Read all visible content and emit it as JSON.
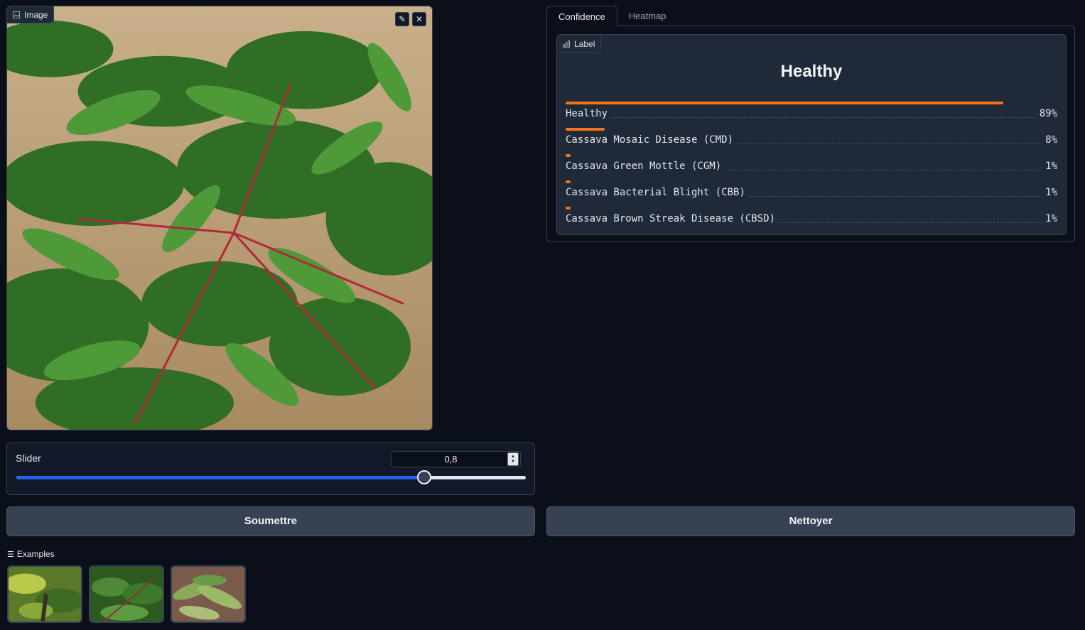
{
  "image_input": {
    "label": "Image",
    "tools": [
      "edit-icon",
      "close-icon"
    ]
  },
  "slider": {
    "label": "Slider",
    "value_display": "0,8",
    "value": 0.8,
    "min": 0,
    "max": 1
  },
  "buttons": {
    "submit_label": "Soumettre",
    "clear_label": "Nettoyer"
  },
  "examples": {
    "label": "Examples",
    "count": 3
  },
  "tabs": [
    {
      "label": "Confidence",
      "active": true
    },
    {
      "label": "Heatmap",
      "active": false
    }
  ],
  "output": {
    "badge": "Label",
    "prediction": "Healthy",
    "confidences": [
      {
        "label": "Healthy",
        "display": "89%",
        "value": 0.89
      },
      {
        "label": "Cassava Mosaic Disease (CMD)",
        "display": "8%",
        "value": 0.08
      },
      {
        "label": "Cassava Green Mottle (CGM)",
        "display": "1%",
        "value": 0.01
      },
      {
        "label": "Cassava Bacterial Blight (CBB)",
        "display": "1%",
        "value": 0.01
      },
      {
        "label": "Cassava Brown Streak Disease (CBSD)",
        "display": "1%",
        "value": 0.01
      }
    ]
  },
  "colors": {
    "background": "#0b0f19",
    "accent_bar": "#f97316",
    "slider_fill": "#2563eb"
  }
}
